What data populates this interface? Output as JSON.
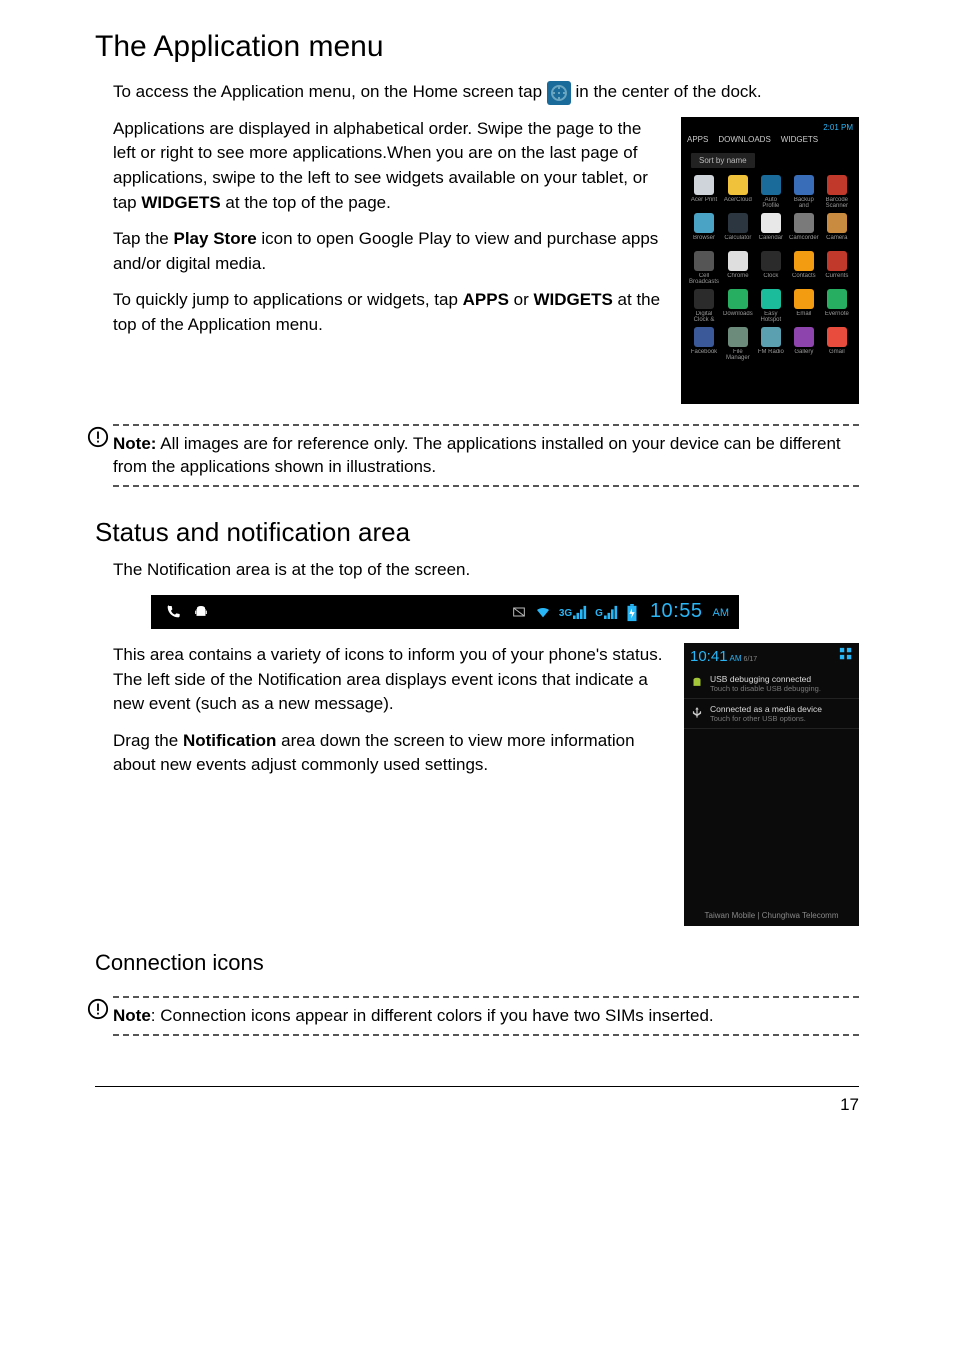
{
  "h1": "The Application menu",
  "p1a": "To access the Application menu, on the Home screen tap ",
  "p1b": " in the center of the dock.",
  "p2a": "Applications are displayed in alphabetical order. Swipe the page to the left or right to see more applications.When you are on the last page of applications, swipe to the left to see widgets available on your tablet, or tap ",
  "p2b": "WIDGETS",
  "p2c": " at the top of the page.",
  "p3a": "Tap the ",
  "p3b": "Play Store",
  "p3c": " icon to open Google Play to view and purchase apps and/or digital media.",
  "p4a": "To quickly jump to applications or widgets, tap ",
  "p4b": "APPS",
  "p4c": " or ",
  "p4d": "WIDGETS",
  "p4e": " at the top of the Application menu.",
  "appmenu": {
    "time": "2:01 PM",
    "tabs": [
      "APPS",
      "DOWNLOADS",
      "WIDGETS"
    ],
    "sort": "Sort by name",
    "apps": [
      {
        "label": "Acer Print",
        "bg": "#cfd4da"
      },
      {
        "label": "AcerCloud",
        "bg": "#f0c13a"
      },
      {
        "label": "Auto Profile",
        "bg": "#1a6b9a"
      },
      {
        "label": "Backup and Restore",
        "bg": "#3a6db8"
      },
      {
        "label": "Barcode Scanner",
        "bg": "#c0392b"
      },
      {
        "label": "Browser",
        "bg": "#4aa3c4"
      },
      {
        "label": "Calculator",
        "bg": "#2b3640"
      },
      {
        "label": "Calendar",
        "bg": "#e8e8e8"
      },
      {
        "label": "Camcorder",
        "bg": "#7a7a7a"
      },
      {
        "label": "Camera",
        "bg": "#c98b3f"
      },
      {
        "label": "Cell Broadcasts",
        "bg": "#555"
      },
      {
        "label": "Chrome",
        "bg": "#dedede"
      },
      {
        "label": "Clock",
        "bg": "#2b2b2b"
      },
      {
        "label": "Contacts",
        "bg": "#f39c12"
      },
      {
        "label": "Currents",
        "bg": "#c0392b"
      },
      {
        "label": "Digital Clock &",
        "bg": "#2b2b2b"
      },
      {
        "label": "Downloads",
        "bg": "#27ae60"
      },
      {
        "label": "Easy Hotspot",
        "bg": "#1abc9c"
      },
      {
        "label": "Email",
        "bg": "#f39c12"
      },
      {
        "label": "Evernote",
        "bg": "#27ae60"
      },
      {
        "label": "Facebook",
        "bg": "#3b5998"
      },
      {
        "label": "File Manager",
        "bg": "#6d8b7a"
      },
      {
        "label": "FM Radio",
        "bg": "#5aa0b0"
      },
      {
        "label": "Gallery",
        "bg": "#8e44ad"
      },
      {
        "label": "Gmail",
        "bg": "#e74c3c"
      }
    ]
  },
  "note1a": "Note:",
  "note1b": " All images are for reference only. The applications installed on your device can be different from the applications shown in illustrations.",
  "h2": "Status and notification area",
  "p5": "The Notification area is at the top of the screen.",
  "statusbar": {
    "time": "10:55",
    "ampm": "AM",
    "sig3g": "3G",
    "sigG": "G"
  },
  "p6": "This area contains a variety of icons to inform you of your phone's status. The left side of the Notification area displays event icons that indicate a new event (such as a new message).",
  "p7a": "Drag the ",
  "p7b": "Notification",
  "p7c": " area down the screen to view more information about new events adjust commonly used settings.",
  "notif": {
    "time": "10:41",
    "ampm": "AM",
    "date": "6/17",
    "row1t1": "USB debugging connected",
    "row1t2": "Touch to disable USB debugging.",
    "row2t1": "Connected as a media device",
    "row2t2": "Touch for other USB options.",
    "footer": "Taiwan Mobile  |  Chunghwa Telecomm"
  },
  "h3": "Connection icons",
  "note2a": "Note",
  "note2b": ": Connection icons appear in different colors if you have two SIMs inserted.",
  "pagenum": "17"
}
